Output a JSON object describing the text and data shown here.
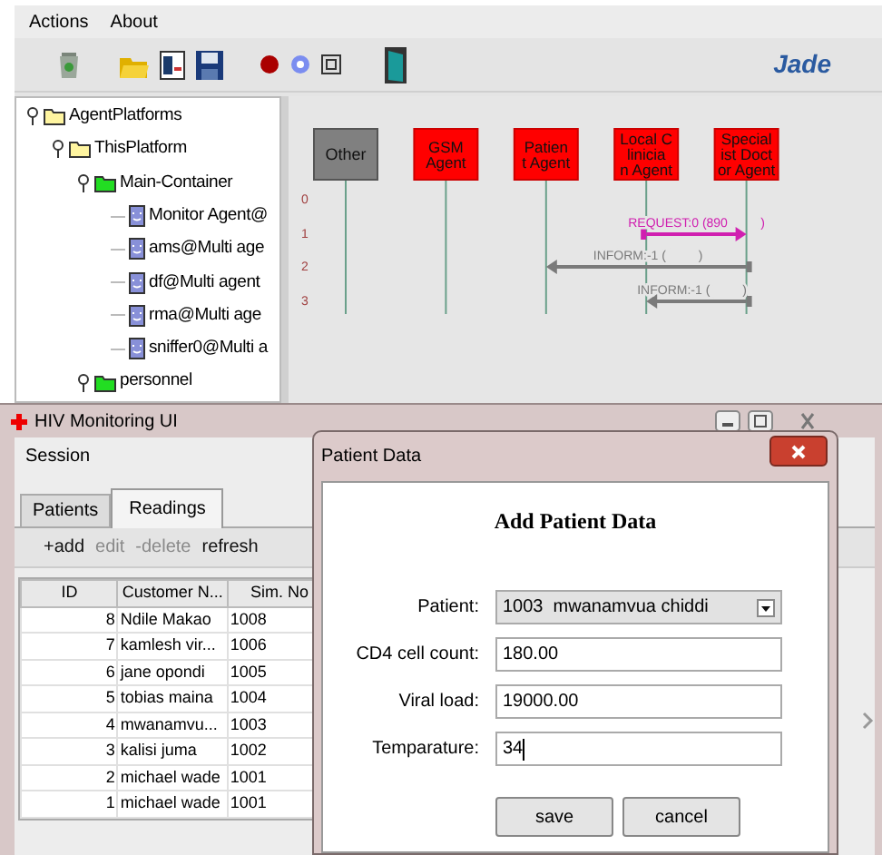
{
  "jade_window": {
    "menu": [
      "Actions",
      "About"
    ],
    "logo": "Jade",
    "tree": [
      {
        "label": "AgentPlatforms",
        "kind": "platform",
        "expanded": true,
        "children": [
          {
            "label": "ThisPlatform",
            "kind": "platform",
            "expanded": true,
            "children": [
              {
                "label": "Main-Container",
                "kind": "container",
                "expanded": true,
                "children": [
                  {
                    "label": "Monitor Agent@",
                    "kind": "agent"
                  },
                  {
                    "label": "ams@Multi age",
                    "kind": "agent"
                  },
                  {
                    "label": "df@Multi agent",
                    "kind": "agent"
                  },
                  {
                    "label": "rma@Multi age",
                    "kind": "agent"
                  },
                  {
                    "label": "sniffer0@Multi a",
                    "kind": "agent"
                  }
                ]
              },
              {
                "label": "personnel",
                "kind": "container",
                "expanded": true
              }
            ]
          }
        ]
      }
    ],
    "sniffer": {
      "agents": [
        {
          "lines": [
            "Other"
          ],
          "kind": "other"
        },
        {
          "lines": [
            "GSM",
            "Agent"
          ],
          "kind": "agent"
        },
        {
          "lines": [
            "Patien",
            "t Agent"
          ],
          "kind": "agent"
        },
        {
          "lines": [
            "Local C",
            "linicia",
            "n Agent"
          ],
          "kind": "agent"
        },
        {
          "lines": [
            "Special",
            "ist Doct",
            "or Agent"
          ],
          "kind": "agent"
        }
      ],
      "row_numbers": [
        "0",
        "1",
        "2",
        "3"
      ],
      "messages": [
        {
          "label": "REQUEST:0 (890",
          "end": ")",
          "kind": "request"
        },
        {
          "label": "INFORM:-1 (",
          "end": ")",
          "kind": "inform"
        },
        {
          "label": "INFORM:-1 (",
          "end": ")",
          "kind": "inform"
        }
      ]
    }
  },
  "hiv_window": {
    "title": "HIV Monitoring UI",
    "menu": [
      "Session"
    ],
    "tabs": [
      {
        "label": "Patients",
        "selected": false
      },
      {
        "label": "Readings",
        "selected": true
      }
    ],
    "toolbar": [
      {
        "label": "+add",
        "disabled": false
      },
      {
        "label": "edit",
        "disabled": true
      },
      {
        "label": "-delete",
        "disabled": true
      },
      {
        "label": "refresh",
        "disabled": false
      }
    ],
    "table": {
      "columns": [
        "ID",
        "Customer N...",
        "Sim. No"
      ],
      "rows": [
        [
          "8",
          "Ndile Makao",
          "1008"
        ],
        [
          "7",
          "kamlesh vir...",
          "1006"
        ],
        [
          "6",
          "jane opondi",
          "1005"
        ],
        [
          "5",
          "tobias maina",
          "1004"
        ],
        [
          "4",
          "mwanamvu...",
          "1003"
        ],
        [
          "3",
          "kalisi juma",
          "1002"
        ],
        [
          "2",
          "michael wade",
          "1001"
        ],
        [
          "1",
          "michael wade",
          "1001"
        ]
      ]
    }
  },
  "dialog": {
    "title": "Patient Data",
    "heading": "Add Patient Data",
    "fields": [
      {
        "label": "Patient:",
        "kind": "select",
        "value": "1003  mwanamvua chiddi"
      },
      {
        "label": "CD4 cell count:",
        "kind": "text",
        "value": "180.00"
      },
      {
        "label": "Viral load:",
        "kind": "text",
        "value": "19000.00"
      },
      {
        "label": "Temparature:",
        "kind": "text",
        "value": "34",
        "focused": true
      }
    ],
    "buttons": [
      "save",
      "cancel"
    ]
  }
}
